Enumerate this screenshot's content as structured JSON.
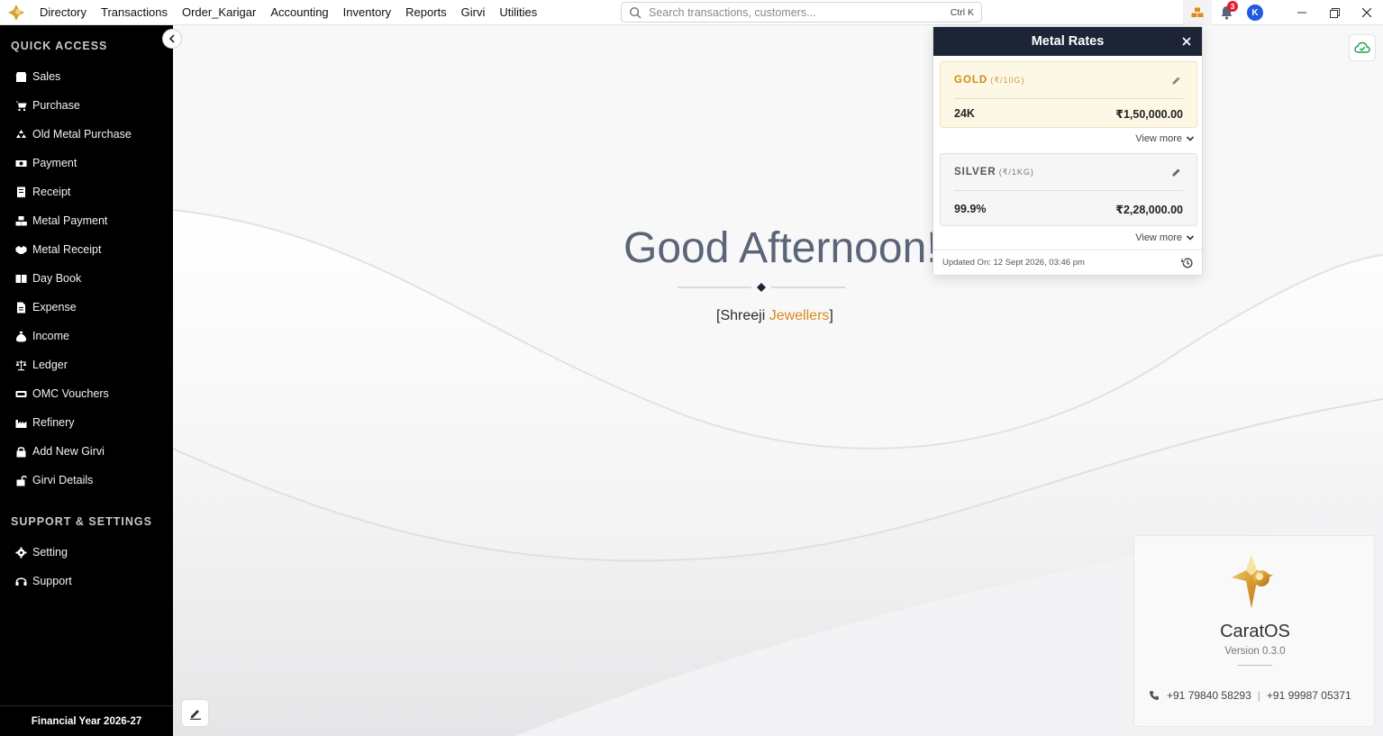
{
  "menu": [
    "Directory",
    "Transactions",
    "Order_Karigar",
    "Accounting",
    "Inventory",
    "Reports",
    "Girvi",
    "Utilities"
  ],
  "search": {
    "placeholder": "Search transactions, customers...",
    "shortcut": "Ctrl K"
  },
  "top_right": {
    "notification_count": "3",
    "avatar_initial": "K"
  },
  "sidebar": {
    "quick_access_heading": "QUICK ACCESS",
    "quick_access": [
      {
        "label": "Sales",
        "icon": "shop-icon"
      },
      {
        "label": "Purchase",
        "icon": "cart-icon"
      },
      {
        "label": "Old Metal Purchase",
        "icon": "recycle-icon"
      },
      {
        "label": "Payment",
        "icon": "money-icon"
      },
      {
        "label": "Receipt",
        "icon": "receipt-icon"
      },
      {
        "label": "Metal Payment",
        "icon": "gold-bars-icon"
      },
      {
        "label": "Metal Receipt",
        "icon": "handshake-icon"
      },
      {
        "label": "Day Book",
        "icon": "book-icon"
      },
      {
        "label": "Expense",
        "icon": "file-invoice-icon"
      },
      {
        "label": "Income",
        "icon": "money-bag-icon"
      },
      {
        "label": "Ledger",
        "icon": "scale-icon"
      },
      {
        "label": "OMC Vouchers",
        "icon": "ticket-icon"
      },
      {
        "label": "Refinery",
        "icon": "industry-icon"
      },
      {
        "label": "Add New Girvi",
        "icon": "lock-icon"
      },
      {
        "label": "Girvi Details",
        "icon": "unlock-icon"
      }
    ],
    "support_heading": "SUPPORT & SETTINGS",
    "support": [
      {
        "label": "Setting",
        "icon": "gear-icon"
      },
      {
        "label": "Support",
        "icon": "headset-icon"
      }
    ],
    "financial_year": "Financial Year 2026-27"
  },
  "main": {
    "greeting": "Good Afternoon!",
    "company_open": "[Shreeji ",
    "company_accent": "Jewellers",
    "company_close": "]"
  },
  "metal_rates": {
    "title": "Metal Rates",
    "gold": {
      "name": "GOLD",
      "unit": "(₹/10G)",
      "purity": "24K",
      "rate": "₹1,50,000.00"
    },
    "silver": {
      "name": "SILVER",
      "unit": "(₹/1KG)",
      "purity": "99.9%",
      "rate": "₹2,28,000.00"
    },
    "view_more": "View more",
    "updated": "Updated On: 12 Sept 2026, 03:46 pm"
  },
  "brand": {
    "name": "CaratOS",
    "version": "Version 0.3.0",
    "phone1": "+91 79840 58293",
    "separator": "|",
    "phone2": "+91 99987 05371"
  },
  "colors": {
    "accent": "#d98a1a",
    "sidebar_bg": "#000000",
    "panel_header": "#1c2436",
    "notification": "#e11d2e",
    "avatar": "#1f5ae0"
  }
}
